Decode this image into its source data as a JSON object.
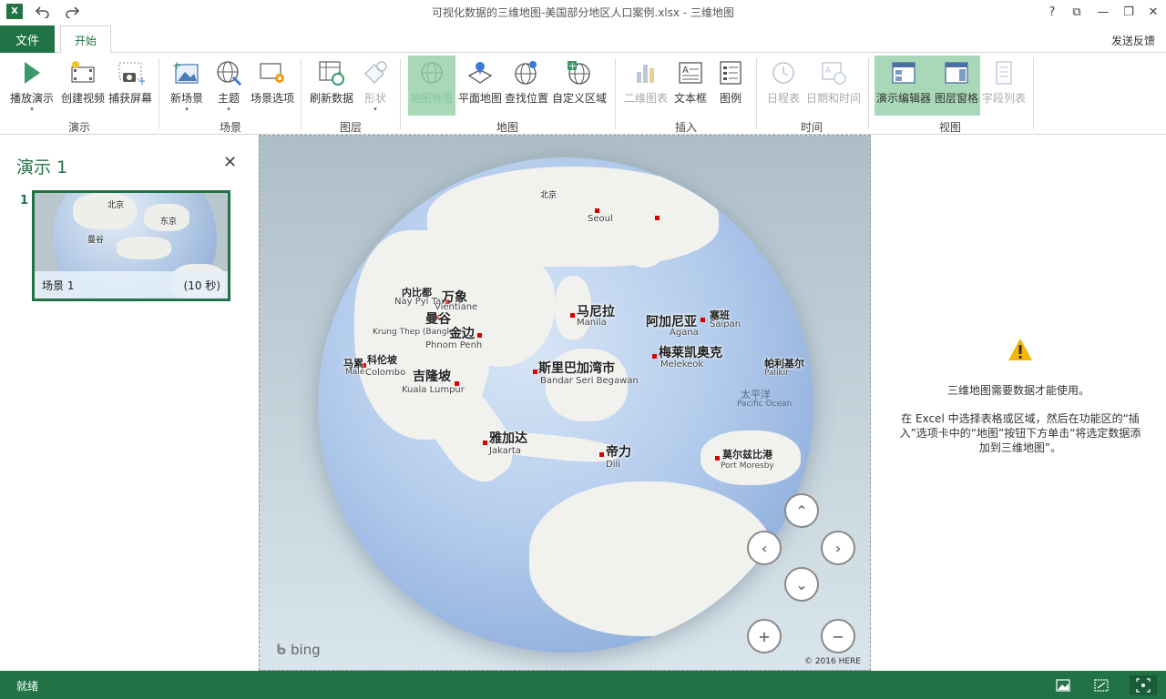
{
  "window": {
    "title": "可视化数据的三维地图-美国部分地区人口案例.xlsx - 三维地图",
    "app_logo": "X",
    "help": "?",
    "restore": "⧉",
    "minimize": "—",
    "maximize": "❐",
    "close": "✕"
  },
  "tabs": {
    "file": "文件",
    "home": "开始",
    "feedback": "发送反馈"
  },
  "ribbon": {
    "groups": {
      "demo": "演示",
      "scene": "场景",
      "layer": "图层",
      "map": "地图",
      "insert": "插入",
      "time": "时间",
      "view": "视图"
    },
    "buttons": {
      "play_tour": "播放演示",
      "create_video": "创建视频",
      "capture_screen": "捕获屏幕",
      "new_scene": "新场景",
      "theme": "主题",
      "scene_options": "场景选项",
      "refresh_data": "刷新数据",
      "shapes": "形状",
      "map_labels": "地图标签",
      "flat_map": "平面地图",
      "find_location": "查找位置",
      "custom_regions": "自定义区域",
      "chart_2d": "二维图表",
      "text_box": "文本框",
      "legend": "图例",
      "timeline": "日程表",
      "date_time": "日期和时间",
      "tour_editor": "演示编辑器",
      "layer_pane": "图层窗格",
      "field_list": "字段列表"
    },
    "dropdown_glyph": "▾"
  },
  "left_panel": {
    "title": "演示 1",
    "close": "✕",
    "scenes": [
      {
        "number": "1",
        "name": "场景 1",
        "duration": "(10 秒)"
      }
    ],
    "thumb_labels": {
      "a": "北京",
      "b": "东京",
      "c": "曼谷"
    }
  },
  "map": {
    "bing": "bing",
    "copyright": "© 2016 HERE",
    "labels": {
      "beijing": "北京",
      "seoul": "Seoul",
      "tokyo_dot": "",
      "neipidu": "内比都",
      "naypyitaw": "Nay Pyi Taw",
      "vientiane_cn": "万象",
      "vientiane": "Vientiane",
      "bangkok_cn": "曼谷",
      "bangkok": "Krung Thep (Bangkok)",
      "phnompenh_cn": "金边",
      "phnompenh": "Phnom Penh",
      "manila_cn": "马尼拉",
      "manila": "Manila",
      "agana_cn": "阿加尼亚",
      "agana": "Agana",
      "saipan_cn": "塞班",
      "saipan": "Saipan",
      "colombo_cn": "科伦坡",
      "colombo": "Colombo",
      "kl_cn": "吉隆坡",
      "kl": "Kuala Lumpur",
      "bsb_cn": "斯里巴加湾市",
      "bsb": "Bandar Seri Begawan",
      "melekeok_cn": "梅莱凯奥克",
      "melekeok": "Melekeok",
      "palikir_cn": "帕利基尔",
      "palikir": "Palikir",
      "pacific_cn": "太平洋",
      "pacific": "Pacific Ocean",
      "jakarta_cn": "雅加达",
      "jakarta": "Jakarta",
      "dili_cn": "帝力",
      "dili": "Dili",
      "pm_cn": "莫尔兹比港",
      "pm": "Port Moresby",
      "male_cn": "马累",
      "male": "Malé"
    },
    "nav": {
      "up": "⌃",
      "left": "‹",
      "right": "›",
      "down": "⌄",
      "zoom_in": "+",
      "zoom_out": "−"
    }
  },
  "right_panel": {
    "message_title": "三维地图需要数据才能使用。",
    "message_body": "在 Excel 中选择表格或区域，然后在功能区的“插入”选项卡中的“地图”按钮下方单击“将选定数据添加到三维地图”。"
  },
  "status": {
    "text": "就绪"
  },
  "colors": {
    "accent": "#217346",
    "active_btn": "#a9d8b8",
    "warning": "#f4b400"
  }
}
